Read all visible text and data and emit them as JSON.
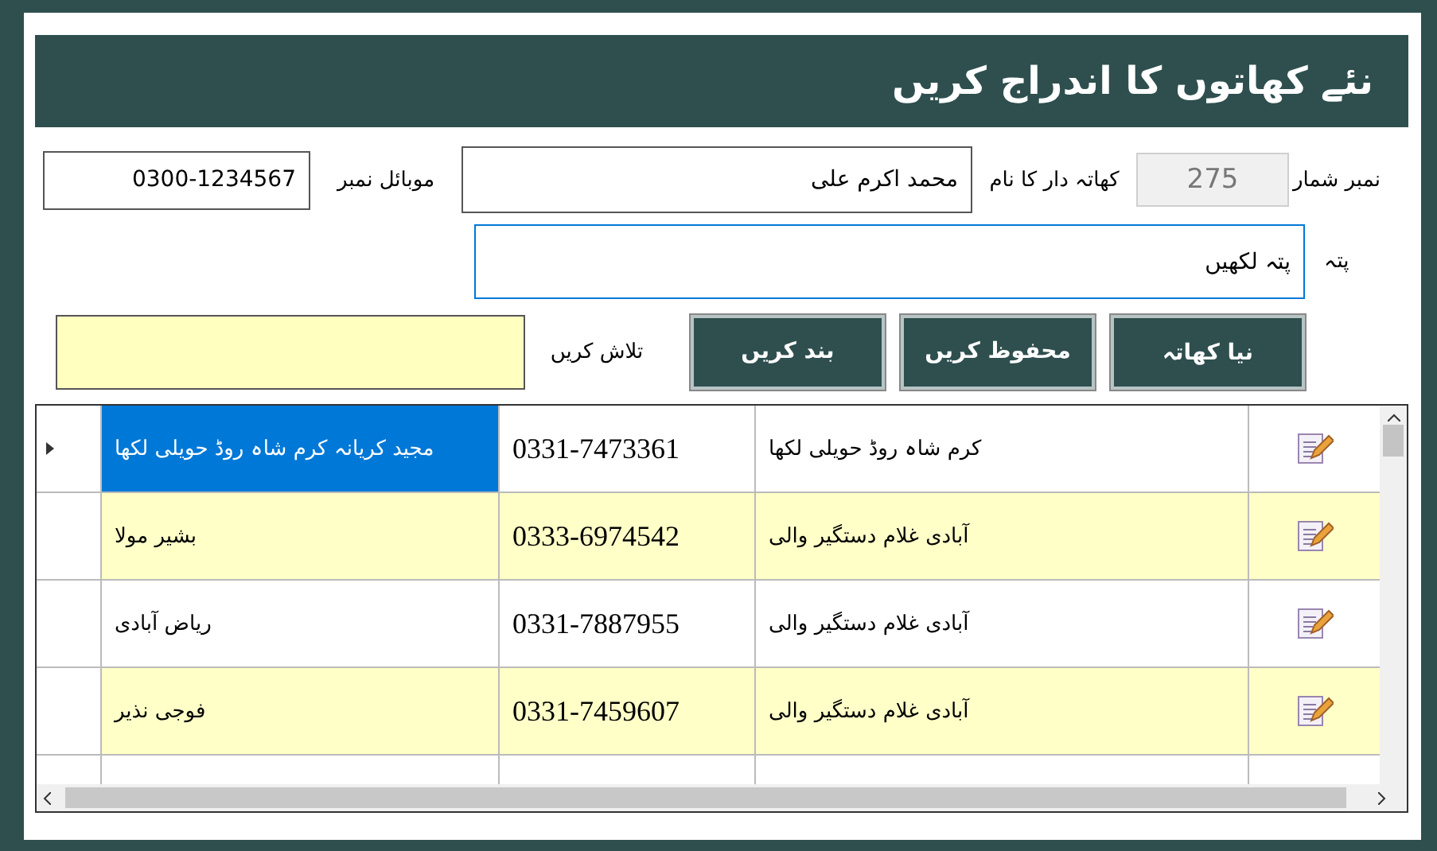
{
  "header": {
    "title": "نئے کھاتوں کا اندراج کریں"
  },
  "form": {
    "serial": {
      "label": "نمبر شمار",
      "value": "275",
      "disabled": true
    },
    "holder": {
      "label": "کھاتہ دار کا نام",
      "value": "محمد اکرم علی"
    },
    "mobile": {
      "label": "موبائل نمبر",
      "value": "0300-1234567"
    },
    "address": {
      "label": "پتہ",
      "value": "پتہ لکھیں",
      "focused": true
    },
    "search": {
      "label": "تلاش کریں"
    }
  },
  "buttons": [
    "نیا کھاتہ",
    "محفوظ کریں",
    "بند کریں"
  ],
  "grid": {
    "rows": [
      {
        "name": "مجید کریانہ کرم شاہ روڈ حویلی لکھا",
        "phone": "0331-7473361",
        "address": "کرم شاہ روڈ حویلی لکھا",
        "selected": true,
        "current": true
      },
      {
        "name": "بشیر مولا",
        "phone": "0333-6974542",
        "address": "آبادی غلام دستگیر والی",
        "selected": false,
        "current": false
      },
      {
        "name": "ریاض آبادی",
        "phone": "0331-7887955",
        "address": "آبادی غلام دستگیر والی",
        "selected": false,
        "current": false
      },
      {
        "name": "فوجی نذیر",
        "phone": "0331-7459607",
        "address": "آبادی غلام دستگیر والی",
        "selected": false,
        "current": false
      }
    ]
  }
}
